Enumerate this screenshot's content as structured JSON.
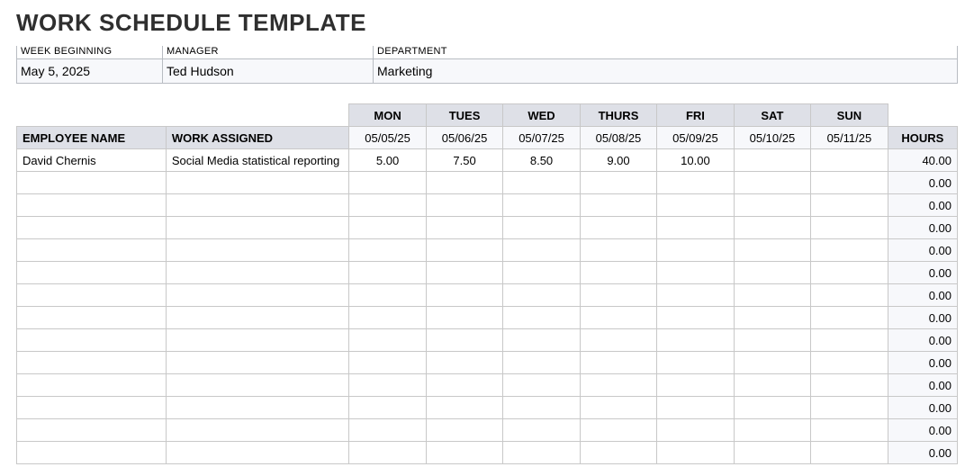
{
  "title": "WORK SCHEDULE TEMPLATE",
  "header": {
    "week_label": "WEEK BEGINNING",
    "week_value": "May 5, 2025",
    "manager_label": "MANAGER",
    "manager_value": "Ted Hudson",
    "department_label": "DEPARTMENT",
    "department_value": "Marketing"
  },
  "columns": {
    "employee": "EMPLOYEE NAME",
    "work": "WORK ASSIGNED",
    "hours": "HOURS",
    "days": [
      "MON",
      "TUES",
      "WED",
      "THURS",
      "FRI",
      "SAT",
      "SUN"
    ],
    "dates": [
      "05/05/25",
      "05/06/25",
      "05/07/25",
      "05/08/25",
      "05/09/25",
      "05/10/25",
      "05/11/25"
    ]
  },
  "rows": [
    {
      "employee": "David Chernis",
      "work": "Social Media statistical reporting",
      "d": [
        "5.00",
        "7.50",
        "8.50",
        "9.00",
        "10.00",
        "",
        ""
      ],
      "hours": "40.00"
    },
    {
      "employee": "",
      "work": "",
      "d": [
        "",
        "",
        "",
        "",
        "",
        "",
        ""
      ],
      "hours": "0.00"
    },
    {
      "employee": "",
      "work": "",
      "d": [
        "",
        "",
        "",
        "",
        "",
        "",
        ""
      ],
      "hours": "0.00"
    },
    {
      "employee": "",
      "work": "",
      "d": [
        "",
        "",
        "",
        "",
        "",
        "",
        ""
      ],
      "hours": "0.00"
    },
    {
      "employee": "",
      "work": "",
      "d": [
        "",
        "",
        "",
        "",
        "",
        "",
        ""
      ],
      "hours": "0.00"
    },
    {
      "employee": "",
      "work": "",
      "d": [
        "",
        "",
        "",
        "",
        "",
        "",
        ""
      ],
      "hours": "0.00"
    },
    {
      "employee": "",
      "work": "",
      "d": [
        "",
        "",
        "",
        "",
        "",
        "",
        ""
      ],
      "hours": "0.00"
    },
    {
      "employee": "",
      "work": "",
      "d": [
        "",
        "",
        "",
        "",
        "",
        "",
        ""
      ],
      "hours": "0.00"
    },
    {
      "employee": "",
      "work": "",
      "d": [
        "",
        "",
        "",
        "",
        "",
        "",
        ""
      ],
      "hours": "0.00"
    },
    {
      "employee": "",
      "work": "",
      "d": [
        "",
        "",
        "",
        "",
        "",
        "",
        ""
      ],
      "hours": "0.00"
    },
    {
      "employee": "",
      "work": "",
      "d": [
        "",
        "",
        "",
        "",
        "",
        "",
        ""
      ],
      "hours": "0.00"
    },
    {
      "employee": "",
      "work": "",
      "d": [
        "",
        "",
        "",
        "",
        "",
        "",
        ""
      ],
      "hours": "0.00"
    },
    {
      "employee": "",
      "work": "",
      "d": [
        "",
        "",
        "",
        "",
        "",
        "",
        ""
      ],
      "hours": "0.00"
    },
    {
      "employee": "",
      "work": "",
      "d": [
        "",
        "",
        "",
        "",
        "",
        "",
        ""
      ],
      "hours": "0.00"
    }
  ]
}
